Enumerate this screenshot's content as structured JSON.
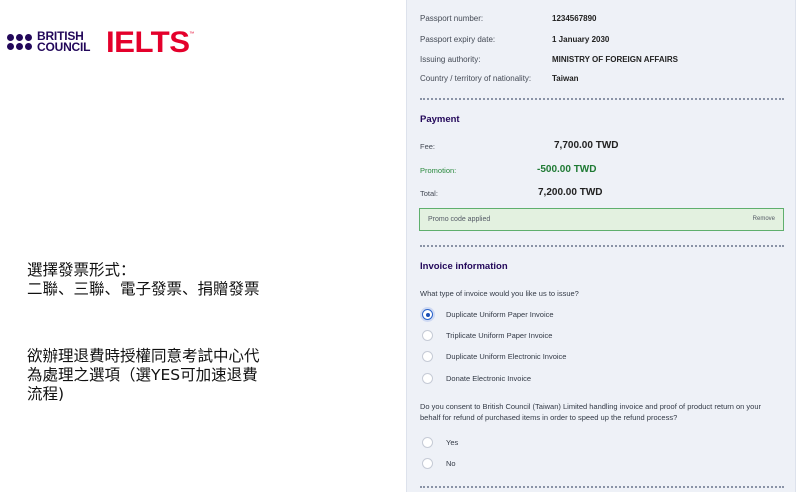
{
  "logos": {
    "british_council": [
      "BRITISH",
      "COUNCIL"
    ],
    "ielts": "IELTS",
    "ielts_tm": "™"
  },
  "notes": {
    "invoice_type": [
      "選擇發票形式：",
      "二聯、三聯、電子發票、捐贈發票"
    ],
    "refund_consent": [
      "欲辦理退費時授權同意考試中心代",
      "為處理之選項（選YES可加速退費",
      "流程)"
    ]
  },
  "passport": [
    {
      "label": "Passport number:",
      "value": "1234567890"
    },
    {
      "label": "Passport expiry date:",
      "value": "1 January 2030"
    },
    {
      "label": "Issuing authority:",
      "value": "MINISTRY OF FOREIGN AFFAIRS"
    },
    {
      "label": "Country / territory of nationality:",
      "value": "Taiwan"
    }
  ],
  "payment": {
    "title": "Payment",
    "fee_label": "Fee:",
    "fee": "7,700.00 TWD",
    "promotion_label": "Promotion:",
    "promotion": "-500.00 TWD",
    "total_label": "Total:",
    "total": "7,200.00 TWD",
    "promo_applied": "Promo code applied",
    "remove": "Remove"
  },
  "invoice": {
    "title": "Invoice information",
    "question": "What type of invoice would you like us to issue?",
    "options": [
      {
        "label": "Duplicate Uniform Paper Invoice",
        "selected": true
      },
      {
        "label": "Triplicate Uniform Paper Invoice",
        "selected": false
      },
      {
        "label": "Duplicate Uniform Electronic Invoice",
        "selected": false
      },
      {
        "label": "Donate Electronic Invoice",
        "selected": false
      }
    ],
    "consent_question": "Do you consent to British Council (Taiwan) Limited handling invoice and proof of product return on your behalf for refund of purchased items in order to speed up the refund process?",
    "consent_options": [
      {
        "label": "Yes",
        "selected": false
      },
      {
        "label": "No",
        "selected": false
      }
    ]
  },
  "colors": {
    "brand_navy": "#23085a",
    "ielts_red": "#e4002b",
    "promo_green": "#1f7a34",
    "radio_blue": "#1b4fb5"
  }
}
